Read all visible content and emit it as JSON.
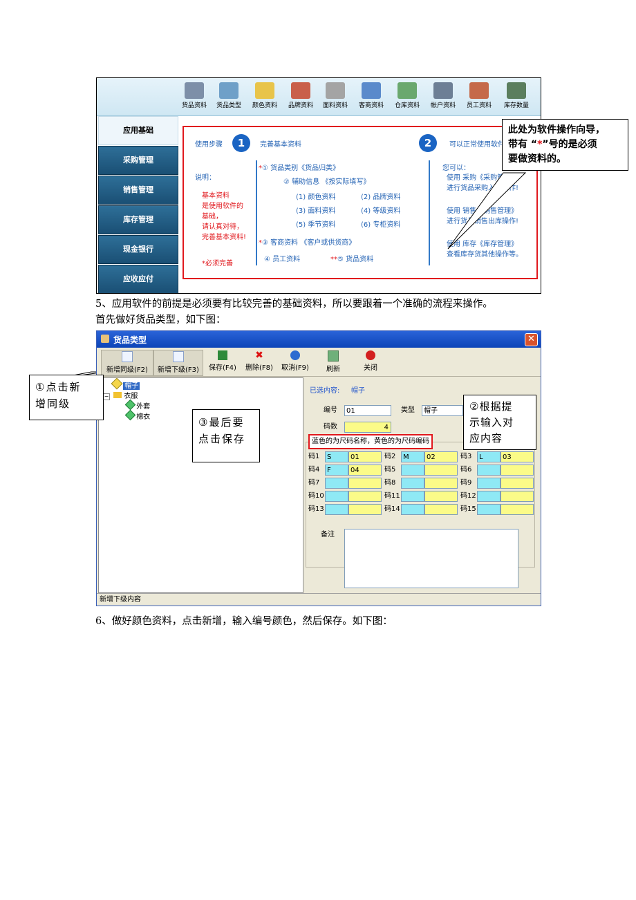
{
  "shot1": {
    "toolbar": [
      "货品资料",
      "货品类型",
      "颜色资料",
      "品牌资料",
      "面料资料",
      "客商资料",
      "仓库资料",
      "帐户资料",
      "员工资料",
      "库存数量"
    ],
    "nav": [
      "应用基础",
      "采购管理",
      "销售管理",
      "库存管理",
      "现金银行",
      "应收应付"
    ],
    "steps_label": "使用步骤",
    "step1_num": "1",
    "step1_text": "完善基本资料",
    "step2_num": "2",
    "step2_text": "可以正常使用软件",
    "note_title": "说明：",
    "note_lines": [
      "基本资料",
      "是使用软件的",
      "基础，",
      "请认真对待，",
      "完善基本资料!"
    ],
    "must_text": "必须完善",
    "star": "*",
    "double_star": "**",
    "item1": "① 货品类别《货品归类》",
    "item2": "② 辅助信息 《按实际填写》",
    "sub_items": [
      "(1) 颜色资料",
      "(2) 品牌资料",
      "(3) 面料资料",
      "(4) 等级资料",
      "(5) 季节资料",
      "(6) 专柜资料"
    ],
    "item3": "③ 客商资料 《客户或供货商》",
    "item4": "④ 员工资料",
    "item5": "⑤ 货品资料",
    "can_title": "您可以：",
    "can_lines": [
      "使用 采购《采购管理》",
      "进行货品采购入库操作!",
      "使用 销售《销售管理》",
      "进行货品销售出库操作!",
      "使用 库存《库存管理》",
      "查看库存货其他操作等。"
    ]
  },
  "callout1": {
    "line1": "此处为软件操作向导，",
    "line2a": "带有 “",
    "line2star": "*",
    "line2b": "”号的是必须",
    "line3": "要做资料的。"
  },
  "para5_line1": "5、应用软件的前提是必须要有比较完善的基础资料，所以要跟着一个准确的流程来操作。",
  "para5_line2": "首先做好货品类型，如下图：",
  "dialog": {
    "title": "货品类型",
    "close": "✕",
    "toolbar": [
      "新增同级(F2)",
      "新增下级(F3)",
      "保存(F4)",
      "删除(F8)",
      "取消(F9)",
      "刷新",
      "关闭"
    ],
    "tree": {
      "root1": "帽子",
      "root2": "衣服",
      "child1": "外套",
      "child2": "棉衣"
    },
    "selected_label": "已选内容:",
    "selected_value": "帽子",
    "code_label": "编号",
    "code_value": "01",
    "type_label": "类型",
    "type_value": "帽子",
    "count_label": "码数",
    "count_value": "4",
    "hint": "蓝色的为尺码名称，黄色的为尺码编码",
    "sizes": [
      {
        "label": "码1",
        "name": "S",
        "code": "01"
      },
      {
        "label": "码2",
        "name": "M",
        "code": "02"
      },
      {
        "label": "码3",
        "name": "L",
        "code": "03"
      },
      {
        "label": "码4",
        "name": "F",
        "code": "04"
      },
      {
        "label": "码5",
        "name": "",
        "code": ""
      },
      {
        "label": "码6",
        "name": "",
        "code": ""
      },
      {
        "label": "码7",
        "name": "",
        "code": ""
      },
      {
        "label": "码8",
        "name": "",
        "code": ""
      },
      {
        "label": "码9",
        "name": "",
        "code": ""
      },
      {
        "label": "码10",
        "name": "",
        "code": ""
      },
      {
        "label": "码11",
        "name": "",
        "code": ""
      },
      {
        "label": "码12",
        "name": "",
        "code": ""
      },
      {
        "label": "码13",
        "name": "",
        "code": ""
      },
      {
        "label": "码14",
        "name": "",
        "code": ""
      },
      {
        "label": "码15",
        "name": "",
        "code": ""
      }
    ],
    "remark_label": "备注",
    "status": "新增下级内容"
  },
  "callout_add": {
    "line1": "①点击新",
    "line2": "增同级"
  },
  "callout_save": {
    "line1": "③最后要",
    "line2": "点击保存"
  },
  "callout_input": {
    "line1": "②根据提",
    "line2": "示输入对",
    "line3": "应内容"
  },
  "para6": "6、做好颜色资料，点击新增，输入编号颜色，然后保存。如下图："
}
